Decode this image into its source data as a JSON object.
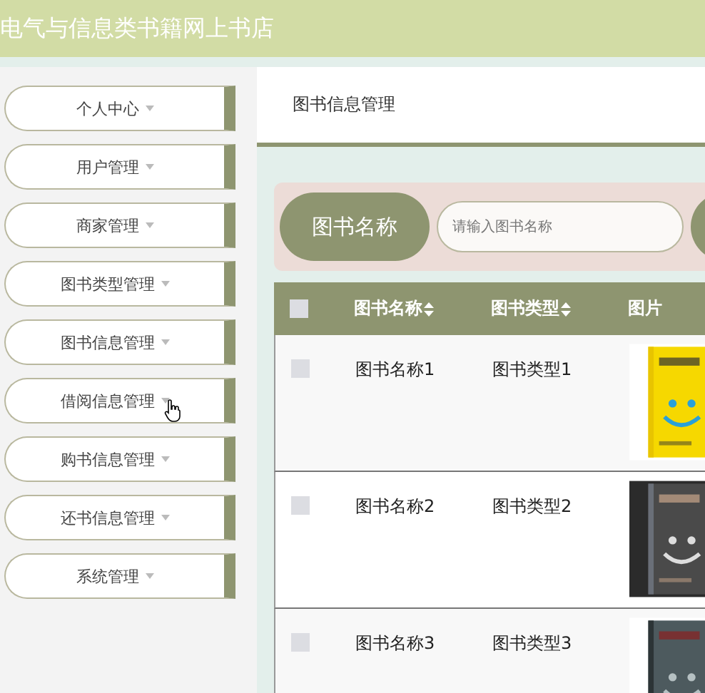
{
  "header": {
    "title": "电气与信息类书籍网上书店"
  },
  "sidebar": {
    "items": [
      {
        "label": "个人中心",
        "hovered": false
      },
      {
        "label": "用户管理",
        "hovered": false
      },
      {
        "label": "商家管理",
        "hovered": false
      },
      {
        "label": "图书类型管理",
        "hovered": false
      },
      {
        "label": "图书信息管理",
        "hovered": false
      },
      {
        "label": "借阅信息管理",
        "hovered": true
      },
      {
        "label": "购书信息管理",
        "hovered": false
      },
      {
        "label": "还书信息管理",
        "hovered": false
      },
      {
        "label": "系统管理",
        "hovered": false
      }
    ]
  },
  "breadcrumb": "图书信息管理",
  "search": {
    "label": "图书名称",
    "placeholder": "请输入图书名称"
  },
  "table": {
    "select_all_checked": false,
    "columns": [
      {
        "label": "图书名称",
        "sortable": true
      },
      {
        "label": "图书类型",
        "sortable": true
      },
      {
        "label": "图片",
        "sortable": false
      }
    ],
    "rows": [
      {
        "checked": false,
        "name": "图书名称1",
        "type": "图书类型1"
      },
      {
        "checked": false,
        "name": "图书名称2",
        "type": "图书类型2"
      },
      {
        "checked": false,
        "name": "图书名称3",
        "type": "图书类型3"
      }
    ]
  }
}
